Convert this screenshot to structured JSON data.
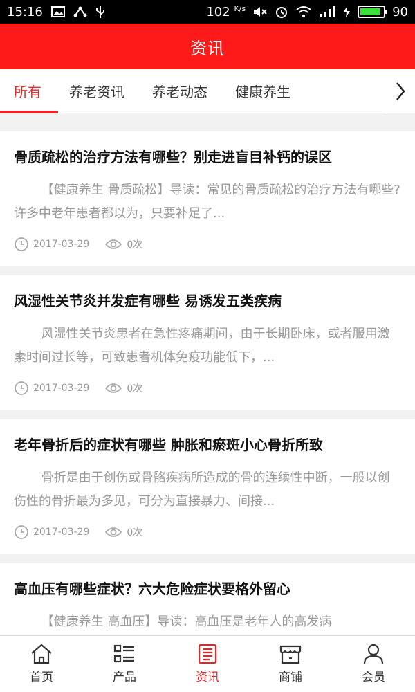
{
  "statusbar": {
    "time": "15:16",
    "net_speed": "102",
    "net_unit": "K/s",
    "battery": "90",
    "battery_level": 0.9
  },
  "header": {
    "title": "资讯"
  },
  "tabs": [
    {
      "label": "所有",
      "active": true
    },
    {
      "label": "养老资讯",
      "active": false
    },
    {
      "label": "养老动态",
      "active": false
    },
    {
      "label": "健康养生",
      "active": false
    }
  ],
  "articles": [
    {
      "title": "骨质疏松的治疗方法有哪些？别走进盲目补钙的误区",
      "summary": "【健康养生 骨质疏松】导读：常见的骨质疏松的治疗方法有哪些?许多中老年患者都以为，只要补足了...",
      "date": "2017-03-29",
      "views": "0次"
    },
    {
      "title": "风湿性关节炎并发症有哪些 易诱发五类疾病",
      "summary": "风湿性关节炎患者在急性疼痛期间，由于长期卧床，或者服用激素时间过长等，可致患者机体免疫功能低下，...",
      "date": "2017-03-29",
      "views": "0次"
    },
    {
      "title": "老年骨折后的症状有哪些 肿胀和瘀斑小心骨折所致",
      "summary": "骨折是由于创伤或骨骼疾病所造成的骨的连续性中断，一般以创伤性的骨折最为多见，可分为直接暴力、间接...",
      "date": "2017-03-29",
      "views": "0次"
    },
    {
      "title": "高血压有哪些症状？六大危险症状要格外留心",
      "summary": "【健康养生 高血压】导读：高血压是老年人的高发病",
      "date": "",
      "views": ""
    }
  ],
  "bottom_nav": [
    {
      "label": "首页",
      "icon": "home-icon",
      "active": false
    },
    {
      "label": "产品",
      "icon": "list-icon",
      "active": false
    },
    {
      "label": "资讯",
      "icon": "news-icon",
      "active": true
    },
    {
      "label": "商铺",
      "icon": "shop-icon",
      "active": false
    },
    {
      "label": "会员",
      "icon": "user-icon",
      "active": false
    }
  ],
  "colors": {
    "primary": "#ff1a1a",
    "accent": "#e82525",
    "muted": "#9a9a9a"
  }
}
